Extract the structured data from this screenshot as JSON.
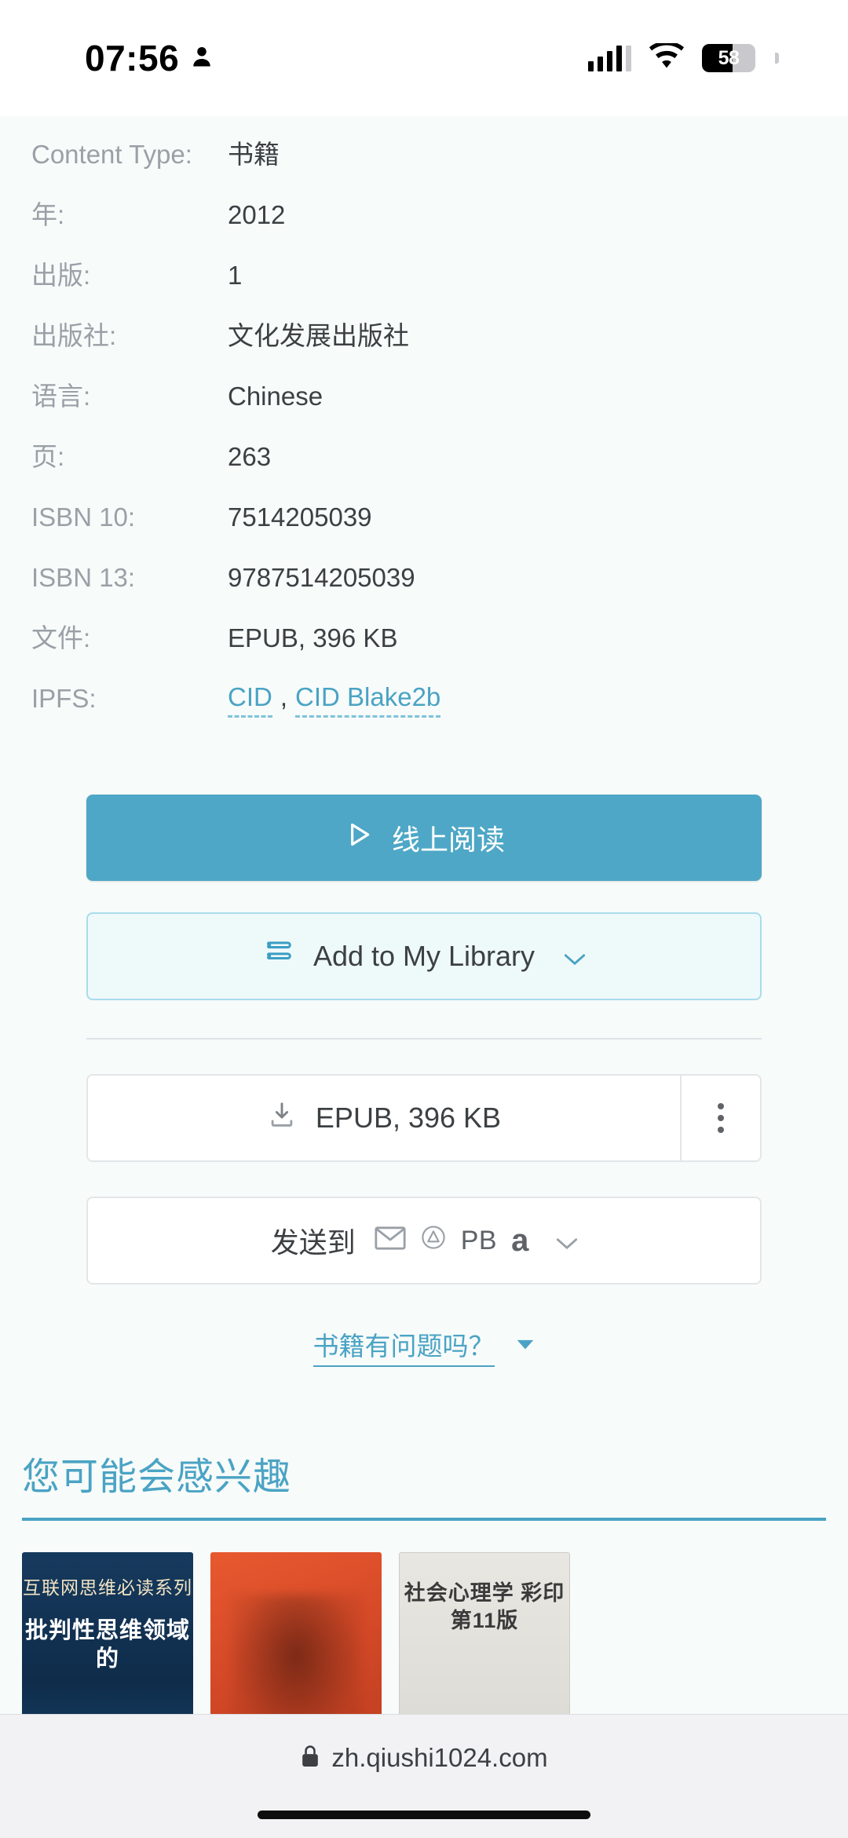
{
  "status_bar": {
    "time": "07:56",
    "person_icon": "person-icon",
    "signal_icon": "cellular-signal-icon",
    "wifi_icon": "wifi-icon",
    "battery_percent": "58",
    "battery_icon": "battery-icon"
  },
  "metadata": {
    "rows": [
      {
        "label": "Content Type:",
        "value": "书籍"
      },
      {
        "label": "年:",
        "value": "2012"
      },
      {
        "label": "出版:",
        "value": "1"
      },
      {
        "label": "出版社:",
        "value": "文化发展出版社"
      },
      {
        "label": "语言:",
        "value": "Chinese"
      },
      {
        "label": "页:",
        "value": "263"
      },
      {
        "label": "ISBN 10:",
        "value": "7514205039"
      },
      {
        "label": "ISBN 13:",
        "value": "9787514205039"
      },
      {
        "label": "文件:",
        "value": "EPUB, 396 KB"
      }
    ],
    "ipfs": {
      "label": "IPFS:",
      "link_cid": "CID",
      "separator": ",",
      "link_blake2b": "CID Blake2b"
    }
  },
  "actions": {
    "read_online_label": "线上阅读",
    "read_online_icon": "play-triangle-icon",
    "add_library_label": "Add to My Library",
    "add_library_icon": "stacked-books-icon",
    "add_library_caret": "chevron-down-icon",
    "download_label": "EPUB, 396 KB",
    "download_icon": "download-icon",
    "kebab_icon": "more-vertical-icon",
    "send_to_label": "发送到",
    "send_to_targets": [
      {
        "name": "email-icon",
        "text": ""
      },
      {
        "name": "drive-icon",
        "text": ""
      },
      {
        "name": "pocketbook-icon",
        "text": "PB"
      },
      {
        "name": "amazon-icon",
        "text": "a"
      }
    ],
    "send_to_caret": "chevron-down-icon",
    "problem_label": "书籍有问题吗？",
    "problem_caret": "caret-down-icon"
  },
  "recommendations": {
    "heading": "您可能会感兴趣",
    "covers": [
      {
        "name": "book-cover-1",
        "line1": "互联网思维必读系列",
        "line2": "批判性思维领域的"
      },
      {
        "name": "book-cover-2",
        "line1": "",
        "line2": ""
      },
      {
        "name": "book-cover-3",
        "line1": "社会心理学 彩印 第11版",
        "line2": ""
      }
    ]
  },
  "browser_bar": {
    "lock_icon": "lock-icon",
    "url": "zh.qiushi1024.com"
  },
  "colors": {
    "accent": "#4aa3c4",
    "primary_button": "#4ea7c6",
    "page_bg": "#f7fbfa"
  }
}
